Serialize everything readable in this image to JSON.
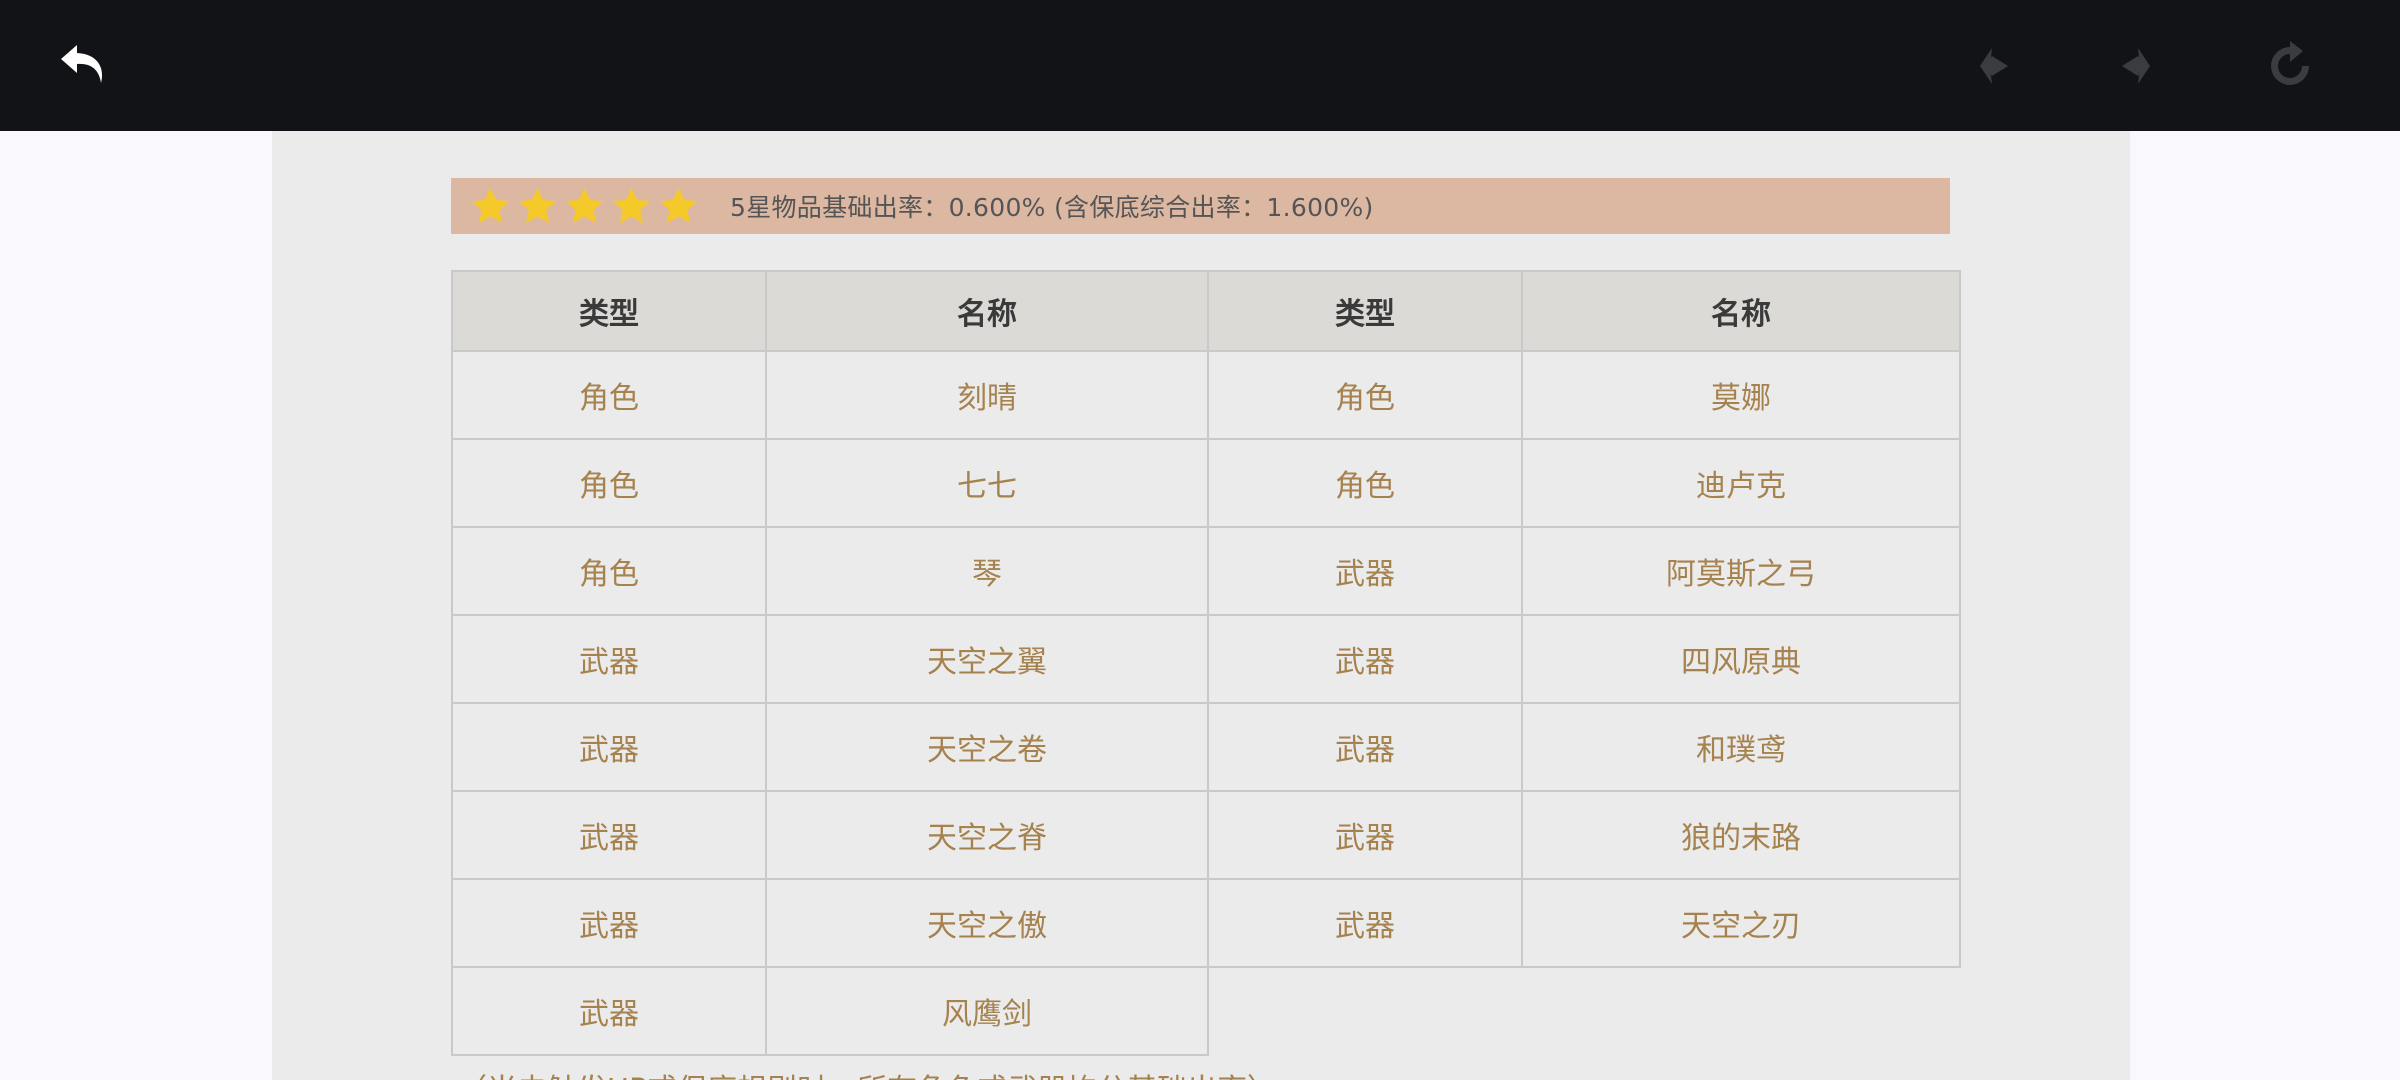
{
  "toolbar": {
    "back_icon": "undo-arrow-icon",
    "prev_icon": "chevron-left-diamond-icon",
    "next_icon": "chevron-right-diamond-icon",
    "refresh_icon": "refresh-icon"
  },
  "banner": {
    "rarity_stars": 5,
    "rate_text": "5星物品基础出率：0.600% (含保底综合出率：1.600%)"
  },
  "table": {
    "headers": [
      "类型",
      "名称",
      "类型",
      "名称"
    ],
    "rows": [
      [
        "角色",
        "刻晴",
        "角色",
        "莫娜"
      ],
      [
        "角色",
        "七七",
        "角色",
        "迪卢克"
      ],
      [
        "角色",
        "琴",
        "武器",
        "阿莫斯之弓"
      ],
      [
        "武器",
        "天空之翼",
        "武器",
        "四风原典"
      ],
      [
        "武器",
        "天空之卷",
        "武器",
        "和璞鸢"
      ],
      [
        "武器",
        "天空之脊",
        "武器",
        "狼的末路"
      ],
      [
        "武器",
        "天空之傲",
        "武器",
        "天空之刃"
      ],
      [
        "武器",
        "风鹰剑",
        "",
        ""
      ]
    ]
  },
  "footnote": "（当未触发UP或保底规则时，所有角色或武器均分基础出率）",
  "colors": {
    "topbar": "#121316",
    "banner": "#dcb8a3",
    "star": "#f5c929",
    "cell_text": "#a5824e",
    "header_bg": "#dcdad6"
  }
}
